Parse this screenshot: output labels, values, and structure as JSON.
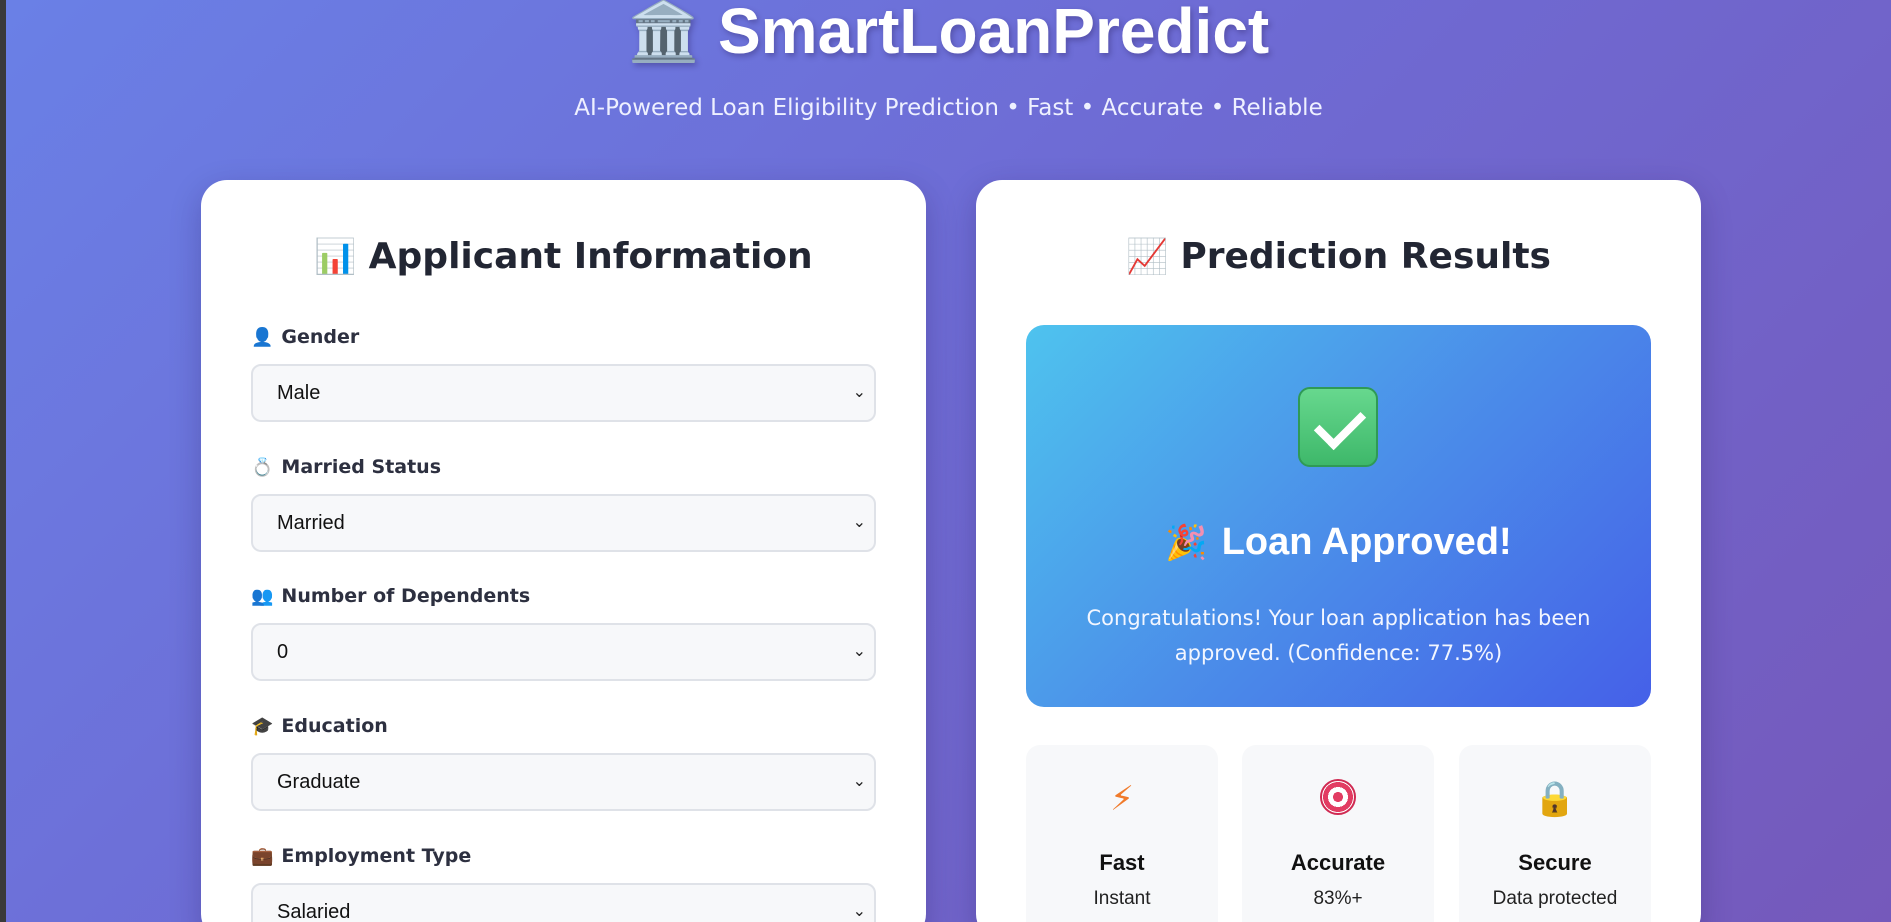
{
  "header": {
    "logo_icon": "🏛️",
    "title": "SmartLoanPredict",
    "subtitle": "AI-Powered Loan Eligibility Prediction • Fast • Accurate • Reliable"
  },
  "form": {
    "icon": "📊",
    "title": "Applicant Information",
    "fields": [
      {
        "icon": "👤",
        "label": "Gender",
        "value": "Male"
      },
      {
        "icon": "💍",
        "label": "Married Status",
        "value": "Married"
      },
      {
        "icon": "👥",
        "label": "Number of Dependents",
        "value": "0"
      },
      {
        "icon": "🎓",
        "label": "Education",
        "value": "Graduate"
      },
      {
        "icon": "💼",
        "label": "Employment Type",
        "value": "Salaried"
      }
    ]
  },
  "results": {
    "icon": "📈",
    "title": "Prediction Results",
    "status_icon": "check-mark-icon",
    "status_icon_color": "#4cc97a",
    "status_title_icon": "🎉",
    "status_title": "Loan Approved!",
    "status_message": "Congratulations! Your loan application has been approved. (Confidence: 77.5%)",
    "gradient": [
      "#4ec3ee",
      "#4560e8"
    ]
  },
  "features": [
    {
      "icon": "⚡",
      "name": "Fast",
      "desc": "Instant"
    },
    {
      "icon": "target-icon",
      "name": "Accurate",
      "desc": "83%+"
    },
    {
      "icon": "🔒",
      "name": "Secure",
      "desc": "Data protected"
    }
  ]
}
